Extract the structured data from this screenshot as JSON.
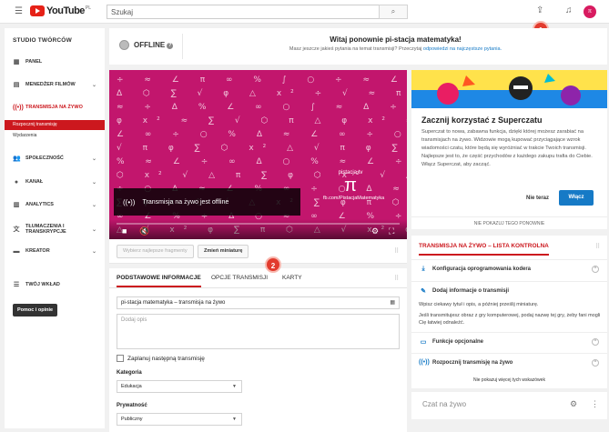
{
  "header": {
    "logo_text": "YouTube",
    "logo_region": "PL",
    "search_placeholder": "Szukaj",
    "avatar_letter": "π"
  },
  "annotations": {
    "badge1": "1",
    "badge2": "2"
  },
  "sidebar": {
    "title": "STUDIO TWÓRCÓW",
    "items": [
      {
        "label": "PANEL",
        "icon": "dashboard-icon"
      },
      {
        "label": "MENEDŻER FILMÓW",
        "icon": "video-manager-icon"
      },
      {
        "label": "TRANSMISJA NA ŻYWO",
        "icon": "live-stream-icon"
      },
      {
        "label": "SPOŁECZNOŚĆ",
        "icon": "community-icon"
      },
      {
        "label": "KANAŁ",
        "icon": "channel-icon"
      },
      {
        "label": "ANALYTICS",
        "icon": "analytics-icon"
      },
      {
        "label": "TŁUMACZENIA I TRANSKRYPCJE",
        "icon": "translate-icon"
      },
      {
        "label": "KREATOR",
        "icon": "create-icon"
      },
      {
        "label": "TWÓJ WKŁAD",
        "icon": "contribution-icon"
      }
    ],
    "sub_items": [
      "Rozpocznij transmisję",
      "Wydarzenia"
    ],
    "help_button": "Pomoc i opinie"
  },
  "status": {
    "state": "OFFLINE",
    "welcome_title": "Witaj ponownie pi-stacja matematyka!",
    "welcome_text": "Masz jeszcze jakieś pytania na temat transmisji? Przeczytaj",
    "welcome_link": "odpowiedzi na najczęstsze pytania."
  },
  "video": {
    "brand_top": "pistacja.tv",
    "brand_mark": "π",
    "brand_url": "fb.com/PistacjaMatematyka",
    "offline_message": "Transmisja na żywo jest offline"
  },
  "video_buttons": {
    "highlight": "Wybierz najlepsze fragmenty",
    "thumbnail": "Zmień miniaturę"
  },
  "tabs": [
    "PODSTAWOWE INFORMACJE",
    "OPCJE TRANSMISJI",
    "KARTY"
  ],
  "form": {
    "title_value": "pi-stacja matematyka – transmisja na żywo",
    "description_placeholder": "Dodaj opis",
    "schedule_label": "Zaplanuj następną transmisję",
    "category_label": "Kategoria",
    "category_value": "Edukacja",
    "privacy_label": "Prywatność",
    "privacy_value": "Publiczny"
  },
  "superchat": {
    "title": "Zacznij korzystać z Superczatu",
    "text": "Superczat to nowa, zabawna funkcja, dzięki której możesz zarabiać na transmisjach na żywo. Widzowie mogą kupować przyciągające wzrok wiadomości czatu, które będą się wyróżniać w trakcie Twoich transmisji. Najlepsze jest to, że część przychodów z każdego zakupu trafia do Ciebie. Włącz Superczat, aby zacząć.",
    "later_button": "Nie teraz",
    "enable_button": "Włącz",
    "dont_show": "NIE POKAZUJ TEGO PONOWNIE"
  },
  "checklist": {
    "title": "TRANSMISJA NA ŻYWO – LISTA KONTROLNA",
    "items": [
      {
        "label": "Konfiguracja oprogramowania kodera",
        "icon": "download-icon"
      },
      {
        "label": "Dodaj informacje o transmisji",
        "icon": "edit-icon"
      },
      {
        "label": "Funkcje opcjonalne",
        "icon": "card-icon"
      },
      {
        "label": "Rozpocznij transmisję na żywo",
        "icon": "live-stream-icon"
      }
    ],
    "desc1": "Wpisz ciekawy tytuł i opis, a później prześlij miniaturę.",
    "desc2": "Jeśli transmitujesz obraz z gry komputerowej, podaj nazwę tej gry, żeby fani mogli Cię łatwiej odnaleźć.",
    "footer": "Nie pokazuj więcej tych wskazówek"
  },
  "chat": {
    "placeholder": "Czat na żywo"
  }
}
